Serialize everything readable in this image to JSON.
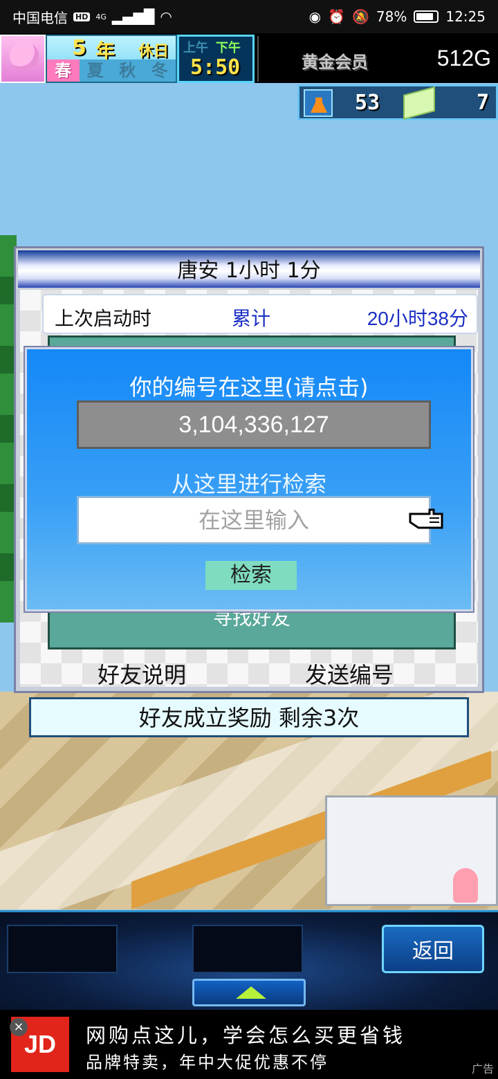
{
  "status_bar": {
    "carrier": "中国电信",
    "hd": "HD",
    "signal": "4G",
    "battery": "78%",
    "battery_level": 0.78,
    "time": "12:25"
  },
  "hud": {
    "year_number": "5",
    "year_unit": "年",
    "holiday": "休日",
    "seasons": [
      "春",
      "夏",
      "秋",
      "冬"
    ],
    "active_season": "春",
    "am_label": "上午",
    "pm_label": "下午",
    "active_period": "下午",
    "clock": "5:50",
    "member_label": "黄金会员",
    "gold": "512G",
    "research_points": "53",
    "tickets": "7"
  },
  "friend_panel": {
    "title": "唐安  1小时 1分",
    "last_launch_label": "上次启动时",
    "cumulative_label": "累计",
    "cumulative_value": "20小时38分",
    "find_friend": "寻找好友",
    "help_link": "好友说明",
    "send_id_link": "发送编号"
  },
  "reward_bar": "好友成立奖励  剩余3次",
  "search_dialog": {
    "your_id_label": "你的编号在这里(请点击)",
    "id_value": "3,104,336,127",
    "search_label": "从这里进行检索",
    "input_placeholder": "在这里输入",
    "search_button": "检索"
  },
  "bottom_nav": {
    "back_button": "返回"
  },
  "ad": {
    "brand": "JD",
    "line1": "网购点这儿，学会怎么买更省钱",
    "line2": "品牌特卖，年中大促优惠不停",
    "tag": "广告",
    "close": "×"
  },
  "colors": {
    "dialog_blue": "#1488f7",
    "search_button": "#7fdcc0",
    "accent_text": "#1b2fc4"
  }
}
